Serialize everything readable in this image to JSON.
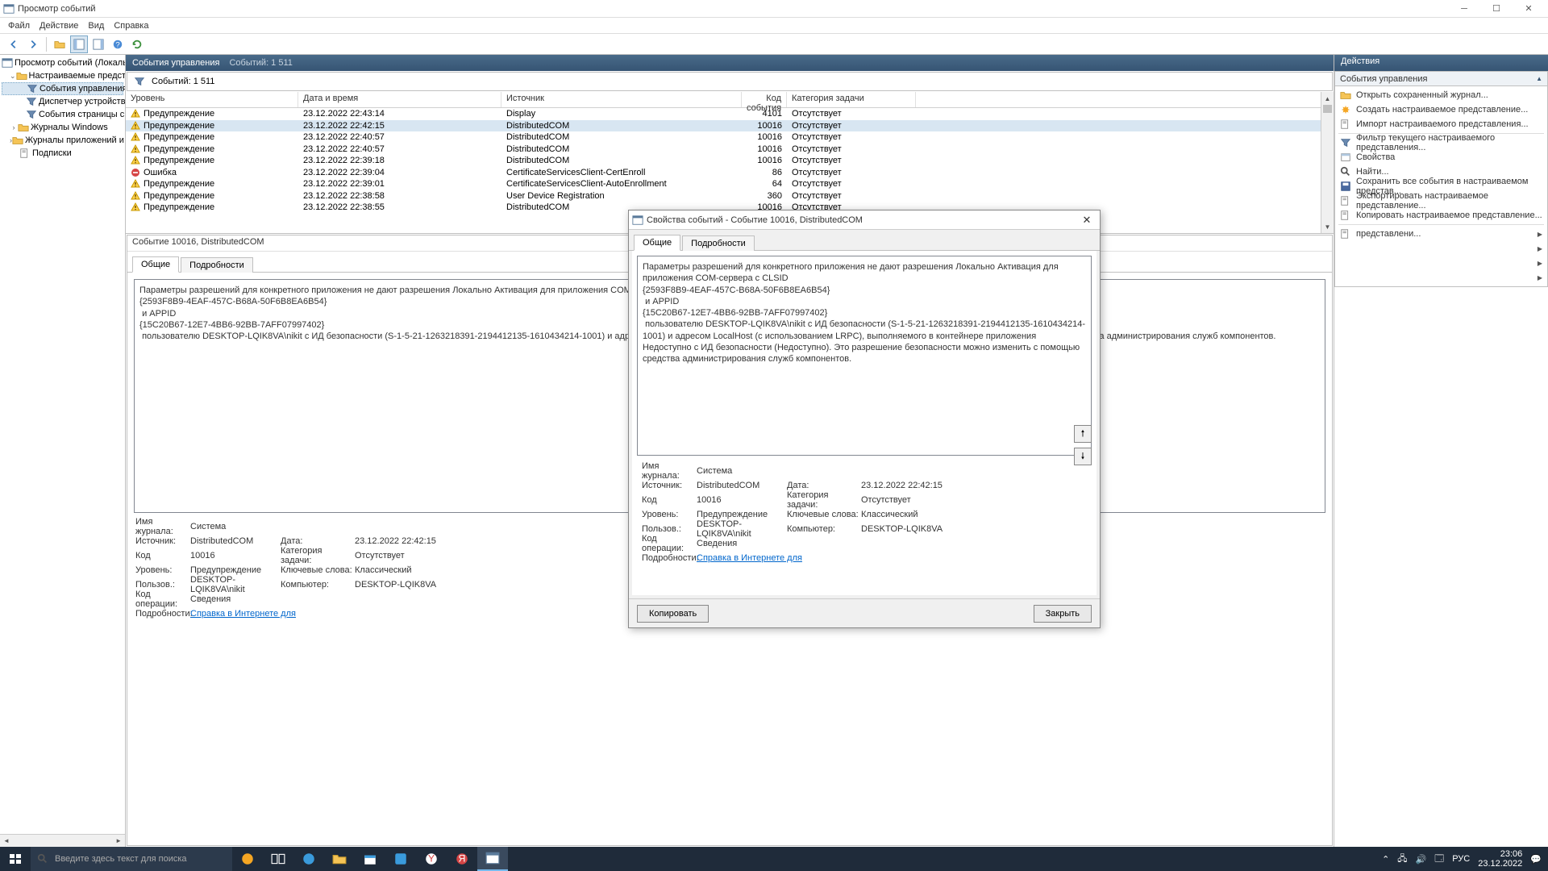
{
  "window": {
    "title": "Просмотр событий",
    "menu": [
      "Файл",
      "Действие",
      "Вид",
      "Справка"
    ]
  },
  "tree": {
    "root": "Просмотр событий (Локальны",
    "custom_views": "Настраиваемые представлен",
    "items": [
      "События управления",
      "Диспетчер устройств - /",
      "События страницы сво"
    ],
    "win_logs": "Журналы Windows",
    "app_logs": "Журналы приложений и сл",
    "subs": "Подписки"
  },
  "center": {
    "title": "События управления",
    "count_header": "Событий: 1 511",
    "filter_label": "Событий: 1 511",
    "columns": {
      "level": "Уровень",
      "date": "Дата и время",
      "source": "Источник",
      "id": "Код события",
      "task": "Категория задачи"
    },
    "rows": [
      {
        "ico": "warn",
        "level": "Предупреждение",
        "date": "23.12.2022 22:43:14",
        "src": "Display",
        "id": "4101",
        "task": "Отсутствует"
      },
      {
        "ico": "warn",
        "level": "Предупреждение",
        "date": "23.12.2022 22:42:15",
        "src": "DistributedCOM",
        "id": "10016",
        "task": "Отсутствует",
        "sel": true
      },
      {
        "ico": "warn",
        "level": "Предупреждение",
        "date": "23.12.2022 22:40:57",
        "src": "DistributedCOM",
        "id": "10016",
        "task": "Отсутствует"
      },
      {
        "ico": "warn",
        "level": "Предупреждение",
        "date": "23.12.2022 22:40:57",
        "src": "DistributedCOM",
        "id": "10016",
        "task": "Отсутствует"
      },
      {
        "ico": "warn",
        "level": "Предупреждение",
        "date": "23.12.2022 22:39:18",
        "src": "DistributedCOM",
        "id": "10016",
        "task": "Отсутствует"
      },
      {
        "ico": "err",
        "level": "Ошибка",
        "date": "23.12.2022 22:39:04",
        "src": "CertificateServicesClient-CertEnroll",
        "id": "86",
        "task": "Отсутствует"
      },
      {
        "ico": "warn",
        "level": "Предупреждение",
        "date": "23.12.2022 22:39:01",
        "src": "CertificateServicesClient-AutoEnrollment",
        "id": "64",
        "task": "Отсутствует"
      },
      {
        "ico": "warn",
        "level": "Предупреждение",
        "date": "23.12.2022 22:38:58",
        "src": "User Device Registration",
        "id": "360",
        "task": "Отсутствует"
      },
      {
        "ico": "warn",
        "level": "Предупреждение",
        "date": "23.12.2022 22:38:55",
        "src": "DistributedCOM",
        "id": "10016",
        "task": "Отсутствует"
      }
    ]
  },
  "detail": {
    "title": "Событие 10016, DistributedCOM",
    "tabs": {
      "general": "Общие",
      "details": "Подробности"
    },
    "desc": "Параметры разрешений для конкретного приложения не дают разрешения Локально Активация для приложения COM-сервера с CLSID\n{2593F8B9-4EAF-457C-B68A-50F6B8EA6B54}\n и APPID\n{15C20B67-12E7-4BB6-92BB-7AFF07997402}\n пользователю DESKTOP-LQIK8VA\\nikit с ИД безопасности (S-1-5-21-1263218391-2194412135-1610434214-1001) и адресом LocalHost (с использован (Недоступно). Это разрешение безопасности можно изменить с помощью средства администрирования служб компонентов.",
    "meta": {
      "log_label": "Имя журнала:",
      "log": "Система",
      "src_label": "Источник:",
      "src": "DistributedCOM",
      "date_label": "Дата:",
      "date": "23.12.2022 22:42:15",
      "id_label": "Код",
      "id": "10016",
      "cat_label": "Категория задачи:",
      "cat": "Отсутствует",
      "level_label": "Уровень:",
      "level": "Предупреждение",
      "kw_label": "Ключевые слова:",
      "kw": "Классический",
      "user_label": "Пользов.:",
      "user": "DESKTOP-LQIK8VA\\nikit",
      "comp_label": "Компьютер:",
      "comp": "DESKTOP-LQIK8VA",
      "op_label": "Код операции:",
      "op": "Сведения",
      "more_label": "Подробности:",
      "more_link": "Справка в Интернете для "
    }
  },
  "actions": {
    "title": "Действия",
    "subtitle": "События управления",
    "items": [
      "Открыть сохраненный журнал...",
      "Создать настраиваемое представление...",
      "Импорт настраиваемого представления...",
      "Фильтр текущего настраиваемого представления...",
      "Свойства",
      "Найти...",
      "Сохранить все события в настраиваемом представ...",
      "Экспортировать настраиваемое представление...",
      "Копировать настраиваемое представление...",
      "представлени..."
    ]
  },
  "dialog": {
    "title": "Свойства событий - Событие 10016, DistributedCOM",
    "tabs": {
      "general": "Общие",
      "details": "Подробности"
    },
    "desc": "Параметры разрешений для конкретного приложения не дают разрешения Локально Активация для приложения COM-сервера с CLSID\n{2593F8B9-4EAF-457C-B68A-50F6B8EA6B54}\n и APPID\n{15C20B67-12E7-4BB6-92BB-7AFF07997402}\n пользователю DESKTOP-LQIK8VA\\nikit с ИД безопасности (S-1-5-21-1263218391-2194412135-1610434214-1001) и адресом LocalHost (с использованием LRPC), выполняемого в контейнере приложения Недоступно с ИД безопасности (Недоступно). Это разрешение безопасности можно изменить с помощью средства администрирования служб компонентов.",
    "copy": "Копировать",
    "close": "Закрыть"
  },
  "taskbar": {
    "search_placeholder": "Введите здесь текст для поиска",
    "lang": "РУС",
    "time": "23:06",
    "date": "23.12.2022"
  }
}
